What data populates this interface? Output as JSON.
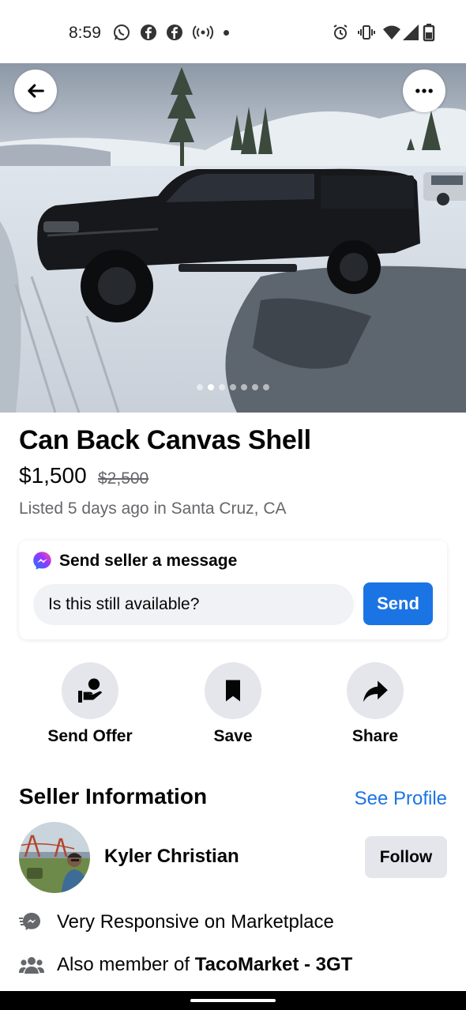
{
  "status_bar": {
    "time": "8:59"
  },
  "listing": {
    "title": "Can Back Canvas Shell",
    "price": "$1,500",
    "original_price": "$2,500",
    "listed": "Listed 5 days ago in Santa Cruz, CA",
    "photo_count": 7,
    "active_photo": 2
  },
  "message": {
    "header": "Send seller a message",
    "input_value": "Is this still available?",
    "send_label": "Send"
  },
  "actions": [
    {
      "label": "Send Offer",
      "icon": "offer-hand-icon"
    },
    {
      "label": "Save",
      "icon": "bookmark-icon"
    },
    {
      "label": "Share",
      "icon": "share-arrow-icon"
    }
  ],
  "seller": {
    "heading": "Seller Information",
    "see_profile": "See Profile",
    "name": "Kyler Christian",
    "follow_label": "Follow",
    "responsive": "Very Responsive on Marketplace",
    "member_prefix": "Also member of ",
    "member_group": "TacoMarket - 3GT"
  },
  "colors": {
    "accent": "#1b74e4",
    "secondary_text": "#65676b",
    "button_gray": "#e4e6eb"
  }
}
